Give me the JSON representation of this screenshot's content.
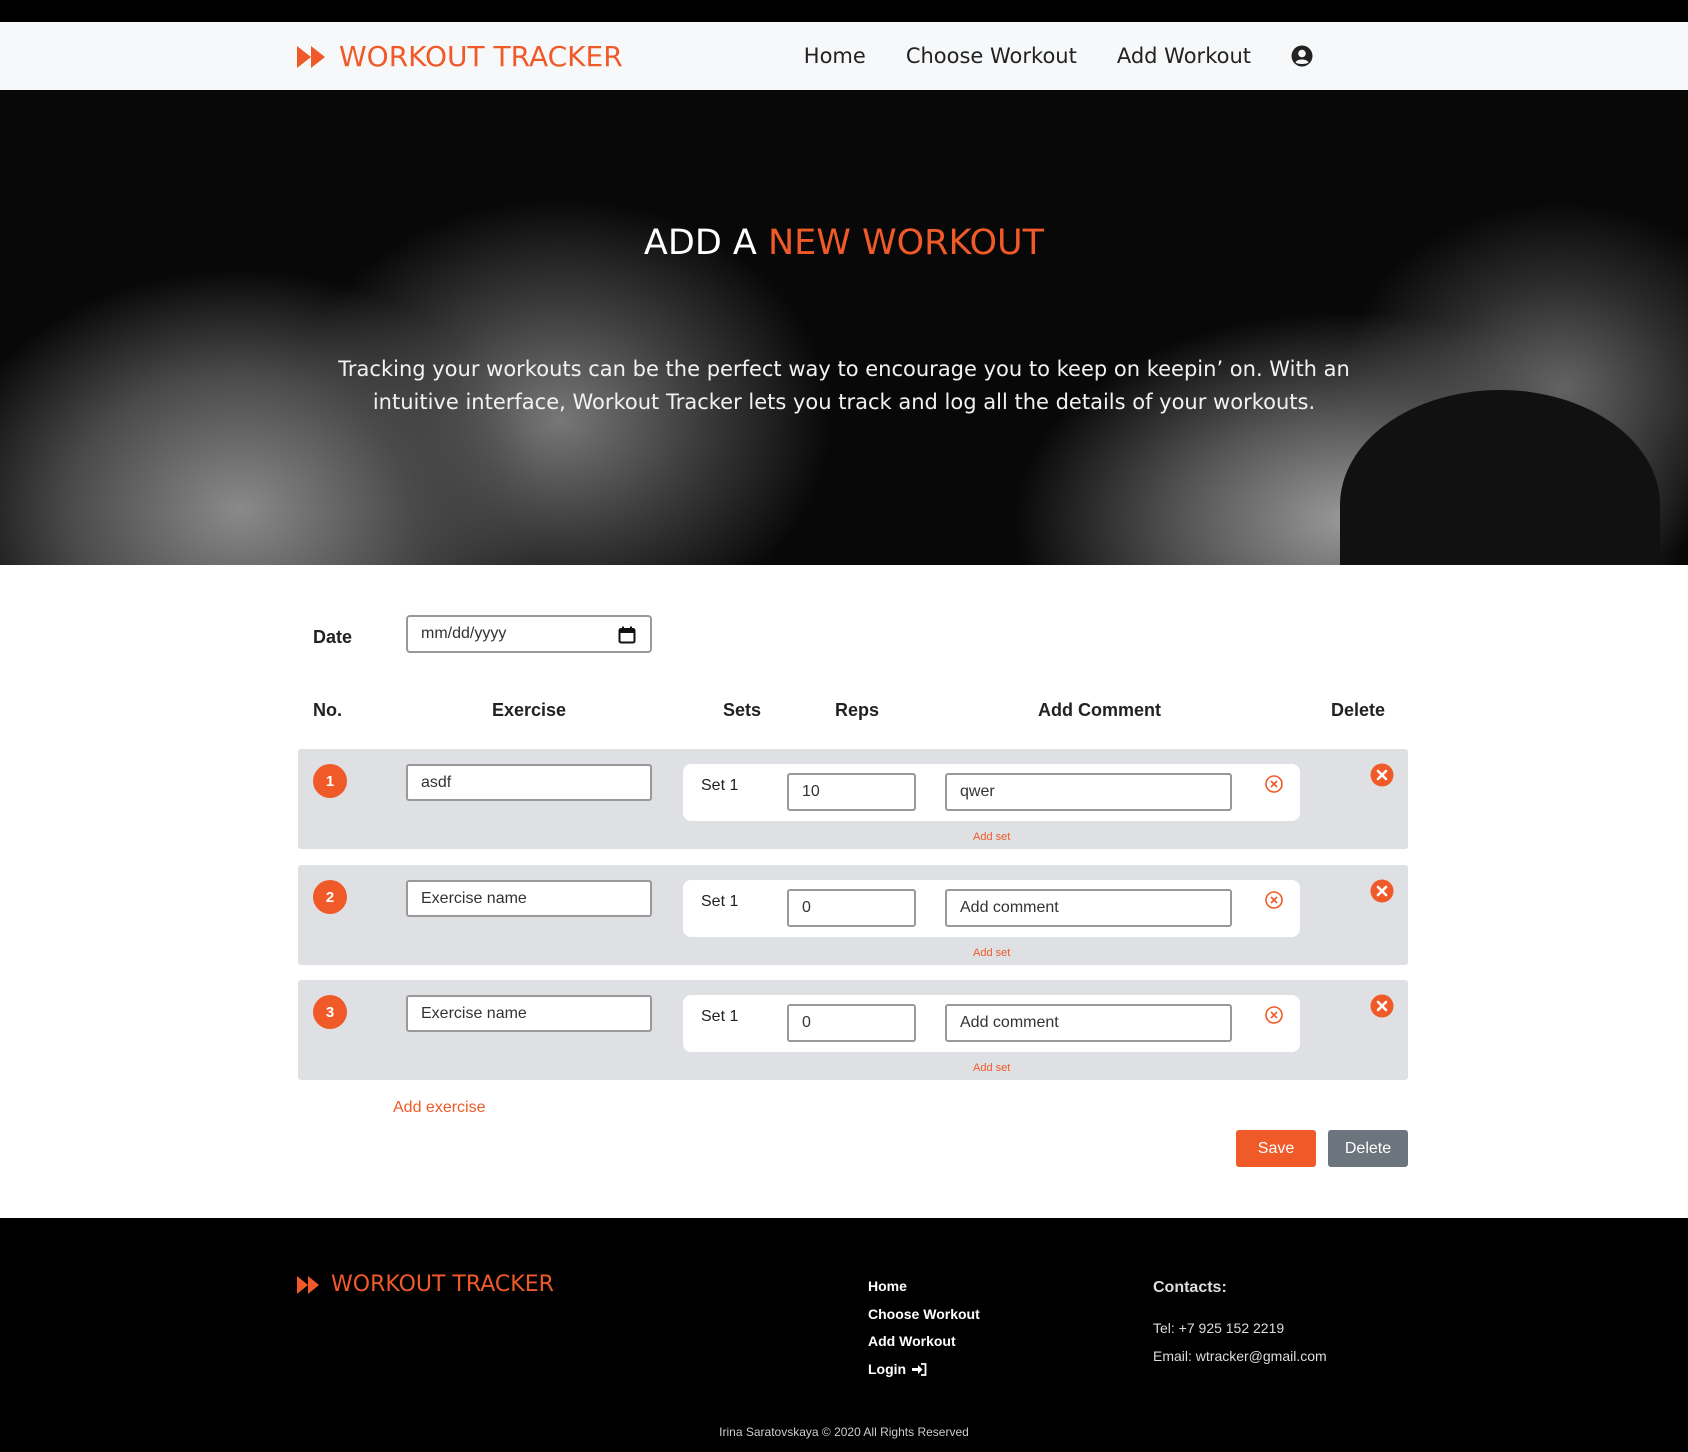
{
  "colors": {
    "accent": "#f05a28",
    "row_bg": "#dee0e3",
    "delete_btn": "#6c757d"
  },
  "nav": {
    "brand": "WORKOUT TRACKER",
    "brand_icon": "fast-forward-icon",
    "links": [
      "Home",
      "Choose Workout",
      "Add Workout"
    ],
    "account_icon": "user-circle-icon"
  },
  "hero": {
    "title_part1": "ADD A ",
    "title_part2": "NEW WORKOUT",
    "text": "Tracking your workouts can be the perfect way to encourage you to keep on keepin’ on. With an intuitive interface, Workout Tracker lets you track and log all the details of your workouts."
  },
  "form": {
    "date_label": "Date",
    "date_placeholder": "mm/dd/yyyy",
    "headers": {
      "no": "No.",
      "exercise": "Exercise",
      "sets": "Sets",
      "reps": "Reps",
      "comment": "Add Comment",
      "delete": "Delete"
    },
    "rows": [
      {
        "no": "1",
        "exercise": "asdf",
        "set_label": "Set 1",
        "reps": "10",
        "comment": "qwer",
        "add_set": "Add set"
      },
      {
        "no": "2",
        "exercise": "Exercise name",
        "set_label": "Set 1",
        "reps": "0",
        "comment": "Add comment",
        "add_set": "Add set"
      },
      {
        "no": "3",
        "exercise": "Exercise name",
        "set_label": "Set 1",
        "reps": "0",
        "comment": "Add comment",
        "add_set": "Add set"
      }
    ],
    "add_exercise": "Add exercise",
    "save": "Save",
    "delete": "Delete"
  },
  "footer": {
    "brand": "WORKOUT TRACKER",
    "links": [
      "Home",
      "Choose Workout",
      "Add Workout",
      "Login"
    ],
    "login_icon": "sign-in-icon",
    "contacts_title": "Contacts:",
    "tel": "Tel: +7 925 152 2219",
    "email": "Email: wtracker@gmail.com",
    "copyright": "Irina Saratovskaya © 2020 All Rights Reserved"
  }
}
